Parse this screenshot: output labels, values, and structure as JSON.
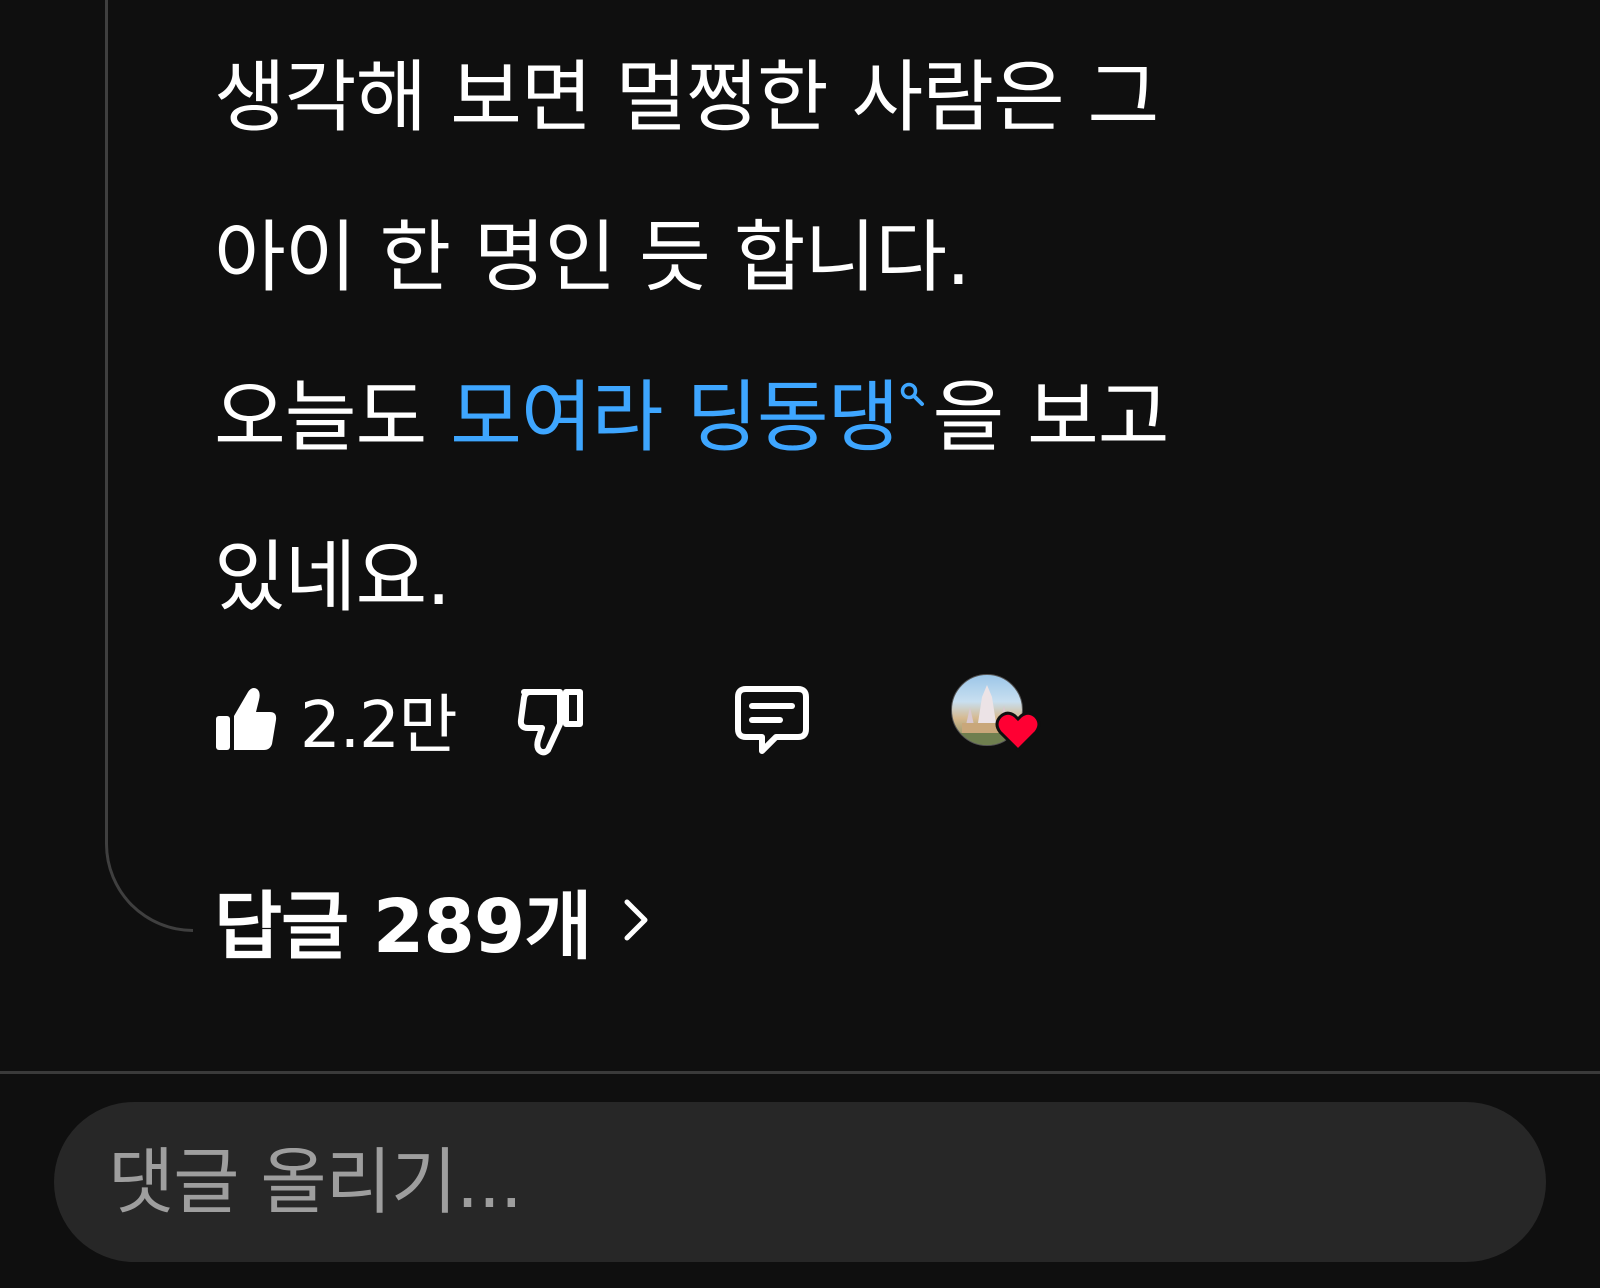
{
  "comment": {
    "lines": [
      "생각해 보면 멀쩡한 사람은 그",
      "아이 한 명인 듯 합니다.",
      "오늘도 ",
      "을 보고",
      "있네요."
    ],
    "hashtag": "모여라 딩동댕",
    "hashtag_color": "#3ea6ff"
  },
  "actions": {
    "like_icon": "thumbs-up-icon",
    "like_count": "2.2만",
    "dislike_icon": "thumbs-down-icon",
    "reply_icon": "comment-icon",
    "creator_heart_icon": "heart-icon"
  },
  "replies": {
    "label": "답글 289개",
    "chevron_icon": "chevron-right-icon"
  },
  "composer": {
    "placeholder": "댓글 올리기..."
  }
}
